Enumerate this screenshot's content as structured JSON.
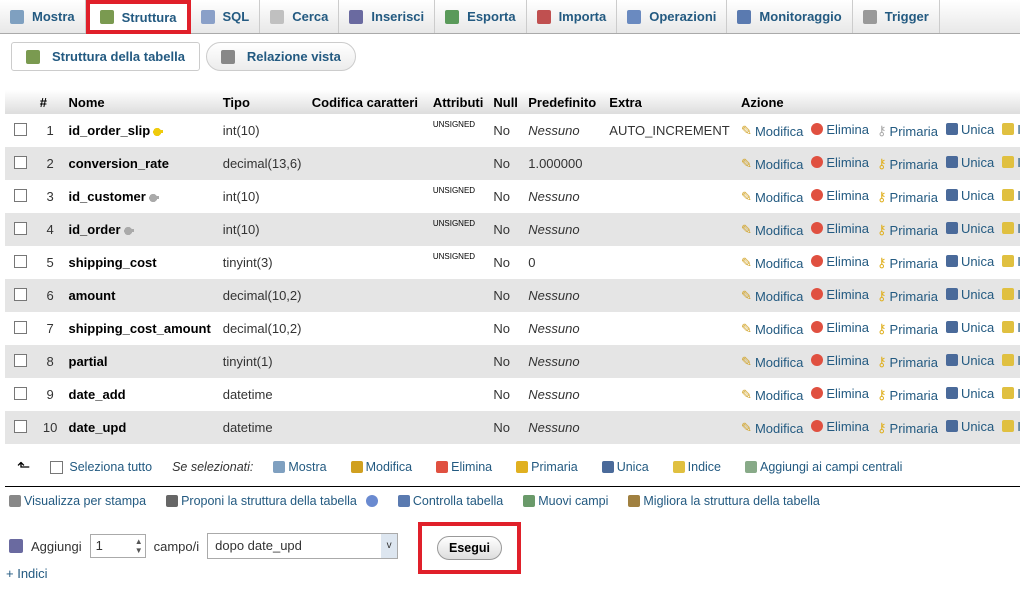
{
  "tabs": [
    {
      "label": "Mostra",
      "icon": "table-icon",
      "color": "#7fa0c0"
    },
    {
      "label": "Struttura",
      "icon": "structure-icon",
      "color": "#7a9a50",
      "selected": true
    },
    {
      "label": "SQL",
      "icon": "sql-icon",
      "color": "#8aa0c8"
    },
    {
      "label": "Cerca",
      "icon": "search-icon",
      "color": "#c0c0c0"
    },
    {
      "label": "Inserisci",
      "icon": "insert-icon",
      "color": "#6a6aa0"
    },
    {
      "label": "Esporta",
      "icon": "export-icon",
      "color": "#5a9a5a"
    },
    {
      "label": "Importa",
      "icon": "import-icon",
      "color": "#c05050"
    },
    {
      "label": "Operazioni",
      "icon": "wrench-icon",
      "color": "#6a8ac0"
    },
    {
      "label": "Monitoraggio",
      "icon": "eye-icon",
      "color": "#5a7ab0"
    },
    {
      "label": "Trigger",
      "icon": "trigger-icon",
      "color": "#999"
    }
  ],
  "subtabs": {
    "structure": "Struttura della tabella",
    "relation": "Relazione vista"
  },
  "columns": [
    "#",
    "Nome",
    "Tipo",
    "Codifica caratteri",
    "Attributi",
    "Null",
    "Predefinito",
    "Extra",
    "Azione"
  ],
  "rows": [
    {
      "n": "1",
      "name": "id_order_slip",
      "key": "primary",
      "type": "int(10)",
      "coll": "",
      "attr": "UNSIGNED",
      "null": "No",
      "def": "Nessuno",
      "extra": "AUTO_INCREMENT"
    },
    {
      "n": "2",
      "name": "conversion_rate",
      "key": "",
      "type": "decimal(13,6)",
      "coll": "",
      "attr": "",
      "null": "No",
      "def": "1.000000",
      "extra": ""
    },
    {
      "n": "3",
      "name": "id_customer",
      "key": "index",
      "type": "int(10)",
      "coll": "",
      "attr": "UNSIGNED",
      "null": "No",
      "def": "Nessuno",
      "extra": ""
    },
    {
      "n": "4",
      "name": "id_order",
      "key": "index",
      "type": "int(10)",
      "coll": "",
      "attr": "UNSIGNED",
      "null": "No",
      "def": "Nessuno",
      "extra": ""
    },
    {
      "n": "5",
      "name": "shipping_cost",
      "key": "",
      "type": "tinyint(3)",
      "coll": "",
      "attr": "UNSIGNED",
      "null": "No",
      "def": "0",
      "extra": ""
    },
    {
      "n": "6",
      "name": "amount",
      "key": "",
      "type": "decimal(10,2)",
      "coll": "",
      "attr": "",
      "null": "No",
      "def": "Nessuno",
      "extra": ""
    },
    {
      "n": "7",
      "name": "shipping_cost_amount",
      "key": "",
      "type": "decimal(10,2)",
      "coll": "",
      "attr": "",
      "null": "No",
      "def": "Nessuno",
      "extra": ""
    },
    {
      "n": "8",
      "name": "partial",
      "key": "",
      "type": "tinyint(1)",
      "coll": "",
      "attr": "",
      "null": "No",
      "def": "Nessuno",
      "extra": ""
    },
    {
      "n": "9",
      "name": "date_add",
      "key": "",
      "type": "datetime",
      "coll": "",
      "attr": "",
      "null": "No",
      "def": "Nessuno",
      "extra": ""
    },
    {
      "n": "10",
      "name": "date_upd",
      "key": "",
      "type": "datetime",
      "coll": "",
      "attr": "",
      "null": "No",
      "def": "Nessuno",
      "extra": ""
    }
  ],
  "actions": {
    "edit": "Modifica",
    "drop": "Elimina",
    "primary": "Primaria",
    "unique": "Unica",
    "index": "I"
  },
  "bulk": {
    "select_all": "Seleziona tutto",
    "with_selected": "Se selezionati:",
    "items": [
      "Mostra",
      "Modifica",
      "Elimina",
      "Primaria",
      "Unica",
      "Indice",
      "Aggiungi ai campi centrali"
    ]
  },
  "links": [
    "Visualizza per stampa",
    "Proponi la struttura della tabella",
    "Controlla tabella",
    "Muovi campi",
    "Migliora la struttura della tabella"
  ],
  "add": {
    "label": "Aggiungi",
    "count": "1",
    "unit": "campo/i",
    "position": "dopo date_upd",
    "go": "Esegui"
  },
  "indexes_link": "+ Indici"
}
